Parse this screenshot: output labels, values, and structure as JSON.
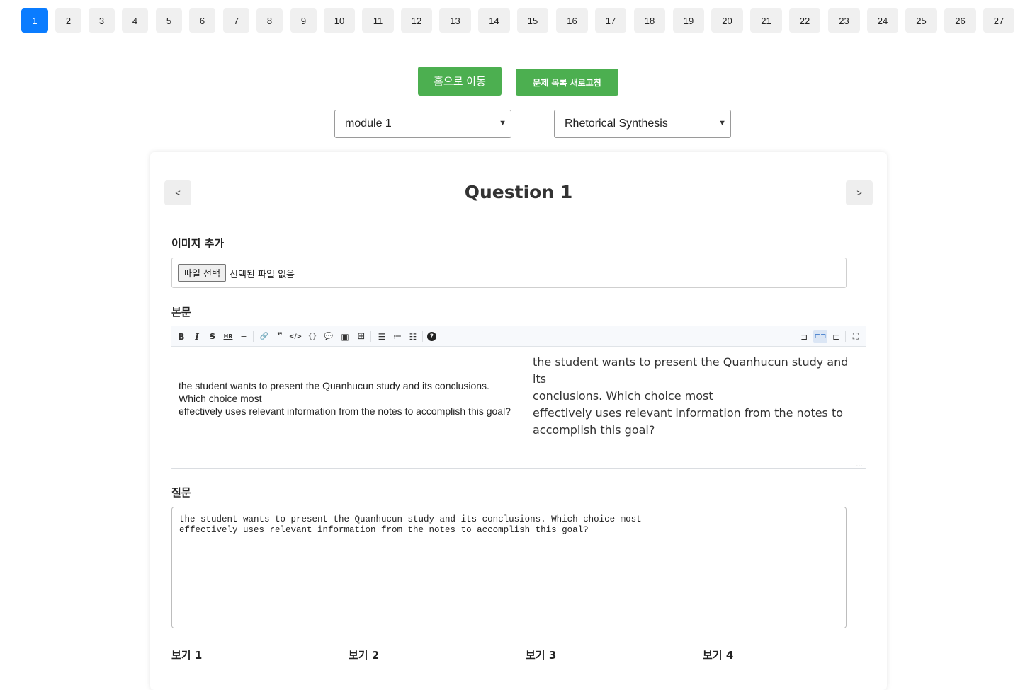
{
  "pagination": {
    "pages": [
      "1",
      "2",
      "3",
      "4",
      "5",
      "6",
      "7",
      "8",
      "9",
      "10",
      "11",
      "12",
      "13",
      "14",
      "15",
      "16",
      "17",
      "18",
      "19",
      "20",
      "21",
      "22",
      "23",
      "24",
      "25",
      "26",
      "27"
    ],
    "active": "1"
  },
  "actions": {
    "home_label": "홈으로 이동",
    "refresh_label": "문제 목록 새로고침"
  },
  "selects": {
    "module": "module 1",
    "type": "Rhetorical Synthesis"
  },
  "card": {
    "prev_label": "<",
    "next_label": ">",
    "title": "Question 1",
    "image_label": "이미지 추가",
    "file_button": "파일 선택",
    "file_status": "선택된 파일 없음",
    "body_label": "본문",
    "editor_source_lines": [
      "the student wants to present the Quanhucun study and its conclusions.",
      "Which choice most",
      "effectively uses relevant information from the notes to accomplish this goal?"
    ],
    "editor_preview_lines": [
      "the student wants to present the Quanhucun study and its",
      "conclusions. Which choice most",
      "effectively uses relevant information from the notes to",
      "accomplish this goal?"
    ],
    "question_label": "질문",
    "question_text": "the student wants to present the Quanhucun study and its conclusions. Which choice most\neffectively uses relevant information from the notes to accomplish this goal?",
    "choices": [
      "보기 1",
      "보기 2",
      "보기 3",
      "보기 4"
    ]
  },
  "toolbar": {
    "items": [
      {
        "name": "bold-icon",
        "glyph": "B"
      },
      {
        "name": "italic-icon",
        "glyph": "I"
      },
      {
        "name": "strikethrough-icon",
        "glyph": "S"
      },
      {
        "name": "hr-icon",
        "glyph": "HR"
      },
      {
        "name": "title-icon",
        "glyph": "≡"
      },
      {
        "name": "link-icon",
        "glyph": "🔗"
      },
      {
        "name": "quote-icon",
        "glyph": "❞"
      },
      {
        "name": "code-icon",
        "glyph": "</>"
      },
      {
        "name": "code-block-icon",
        "glyph": "{}"
      },
      {
        "name": "comment-icon",
        "glyph": "💬"
      },
      {
        "name": "image-icon",
        "glyph": "▣"
      },
      {
        "name": "table-icon",
        "glyph": "⊞"
      },
      {
        "name": "unordered-list-icon",
        "glyph": "☰"
      },
      {
        "name": "ordered-list-icon",
        "glyph": "≔"
      },
      {
        "name": "checklist-icon",
        "glyph": "☷"
      },
      {
        "name": "help-icon",
        "glyph": "?"
      },
      {
        "name": "edit-only-icon",
        "glyph": "⊐"
      },
      {
        "name": "split-view-icon",
        "glyph": "⊏⊐"
      },
      {
        "name": "preview-only-icon",
        "glyph": "⊏"
      },
      {
        "name": "fullscreen-icon",
        "glyph": "⛶"
      }
    ],
    "resize_glyph": "…"
  }
}
